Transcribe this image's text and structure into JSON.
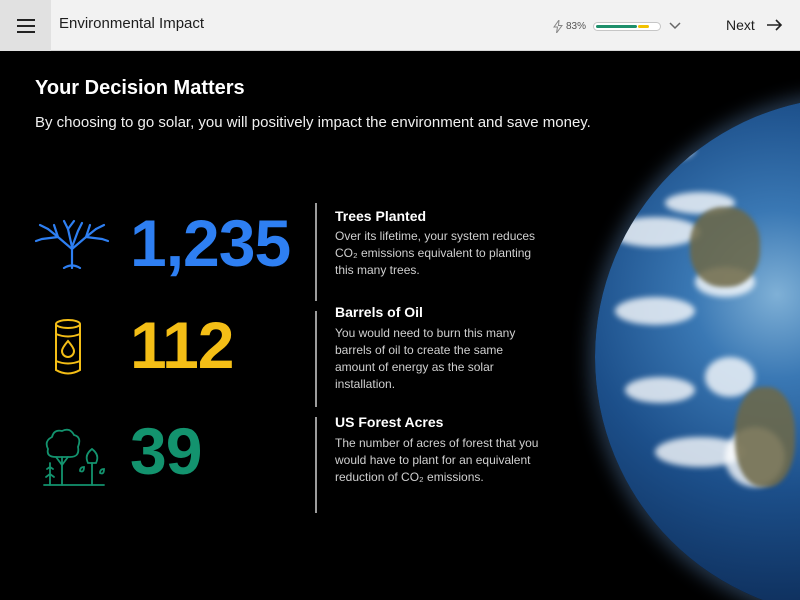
{
  "header": {
    "title": "Environmental Impact",
    "progress_percent": 83,
    "progress_label": "83%",
    "next_label": "Next"
  },
  "main": {
    "heading": "Your Decision Matters",
    "subheading": "By choosing to go solar, you will positively impact the environment and save money."
  },
  "stats": [
    {
      "icon": "tree-icon",
      "value": "1,235",
      "color": "#2e7ff2",
      "title": "Trees Planted",
      "description": "Over its lifetime, your system reduces CO₂ emissions equivalent to planting this many trees."
    },
    {
      "icon": "oil-barrel-icon",
      "value": "112",
      "color": "#f4be16",
      "title": "Barrels of Oil",
      "description": "You would need to burn this many barrels of oil to create the same amount of energy as the solar installation."
    },
    {
      "icon": "forest-icon",
      "value": "39",
      "color": "#13936e",
      "title": "US Forest Acres",
      "description": "The number of acres of forest that you would have to plant for an equivalent reduction of CO₂ emissions."
    }
  ]
}
